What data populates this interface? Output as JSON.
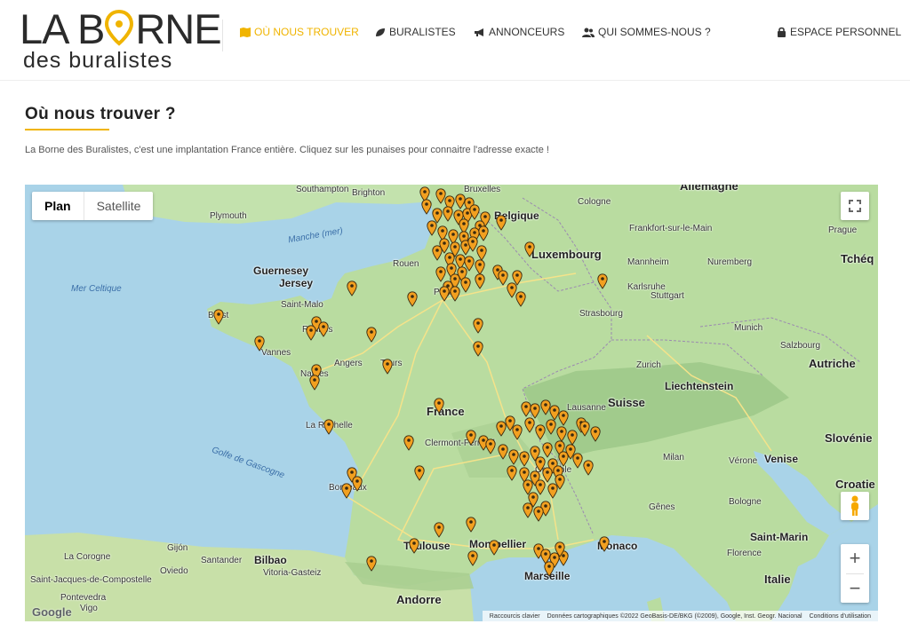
{
  "logo": {
    "line1a": "LA B",
    "line1b": "RNE",
    "line2": "des buralistes"
  },
  "nav": [
    {
      "label": "OÙ NOUS TROUVER",
      "icon": "map-icon",
      "active": true
    },
    {
      "label": "BURALISTES",
      "icon": "leaf-icon",
      "active": false
    },
    {
      "label": "ANNONCEURS",
      "icon": "megaphone-icon",
      "active": false
    },
    {
      "label": "QUI SOMMES-NOUS ?",
      "icon": "users-icon",
      "active": false
    },
    {
      "label": "ESPACE PERSONNEL",
      "icon": "lock-icon",
      "active": false
    }
  ],
  "page": {
    "title": "Où nous trouver ?",
    "intro": "La Borne des Buralistes, c'est une implantation France entière. Cliquez sur les punaises pour connaitre l'adresse exacte !"
  },
  "map": {
    "maptype": {
      "plan": "Plan",
      "satellite": "Satellite"
    },
    "labels": {
      "allemagne": "Allemagne",
      "belgique": "Belgique",
      "bruxelles": "Bruxelles",
      "cologne": "Cologne",
      "southampton": "Southampton",
      "brighton": "Brighton",
      "plymouth": "Plymouth",
      "manche": "Manche (mer)",
      "frankfurt": "Frankfort-sur-le-Main",
      "prague": "Prague",
      "luxembourg": "Luxembourg",
      "mannheim": "Mannheim",
      "nuremberg": "Nuremberg",
      "tcheq": "Tchéq",
      "guernesey": "Guernesey",
      "jersey": "Jersey",
      "rouen": "Rouen",
      "merceltique": "Mer Celtique",
      "paris": "Paris",
      "karlsruhe": "Karlsruhe",
      "stuttgart": "Stuttgart",
      "saintmalo": "Saint-Malo",
      "brest": "Brest",
      "rennes": "Rennes",
      "strasbourg": "Strasbourg",
      "munich": "Munich",
      "vannes": "Vannes",
      "salzbourg": "Salzbourg",
      "angers": "Angers",
      "tours": "Tours",
      "zurich": "Zurich",
      "autriche": "Autriche",
      "nantes": "Nantes",
      "liechtenstein": "Liechtenstein",
      "france": "France",
      "suisse": "Suisse",
      "lausanne": "Lausanne",
      "larochelle": "La Rochelle",
      "slovenie": "Slovénie",
      "clermont": "Clermont-Ferrand",
      "golfe": "Golfe de Gascogne",
      "venise": "Venise",
      "verone": "Vérone",
      "milan": "Milan",
      "bordeaux": "Bordeaux",
      "croatie": "Croatie",
      "genes": "Gênes",
      "toulouse": "Toulouse",
      "montpellier": "Montpellier",
      "monaco": "Monaco",
      "saintmarin": "Saint-Marin",
      "gijon": "Gijón",
      "santander": "Santander",
      "bilbao": "Bilbao",
      "lacorogne": "La Corogne",
      "oviedo": "Oviedo",
      "vitoria": "Vitoria-Gasteiz",
      "santiago": "Saint-Jacques-de-Compostelle",
      "florence": "Florence",
      "marseille": "Marseille",
      "andorre": "Andorre",
      "italie": "Italie",
      "pontevedra": "Pontevedra",
      "vigo": "Vigo",
      "bologne": "Bologne",
      "grenoble": "Grenoble"
    },
    "attribution": [
      "Raccourcis clavier",
      "Données cartographiques ©2022 GeoBasis-DE/BKG (©2009), Google, Inst. Geogr. Nacional",
      "Conditions d'utilisation"
    ],
    "google_logo": "Google",
    "zoom_in": "+",
    "zoom_out": "−"
  },
  "colors": {
    "accent": "#f0b400",
    "pin": "#f2a020",
    "water": "#a9d3e8",
    "land": "#b9dca0"
  }
}
